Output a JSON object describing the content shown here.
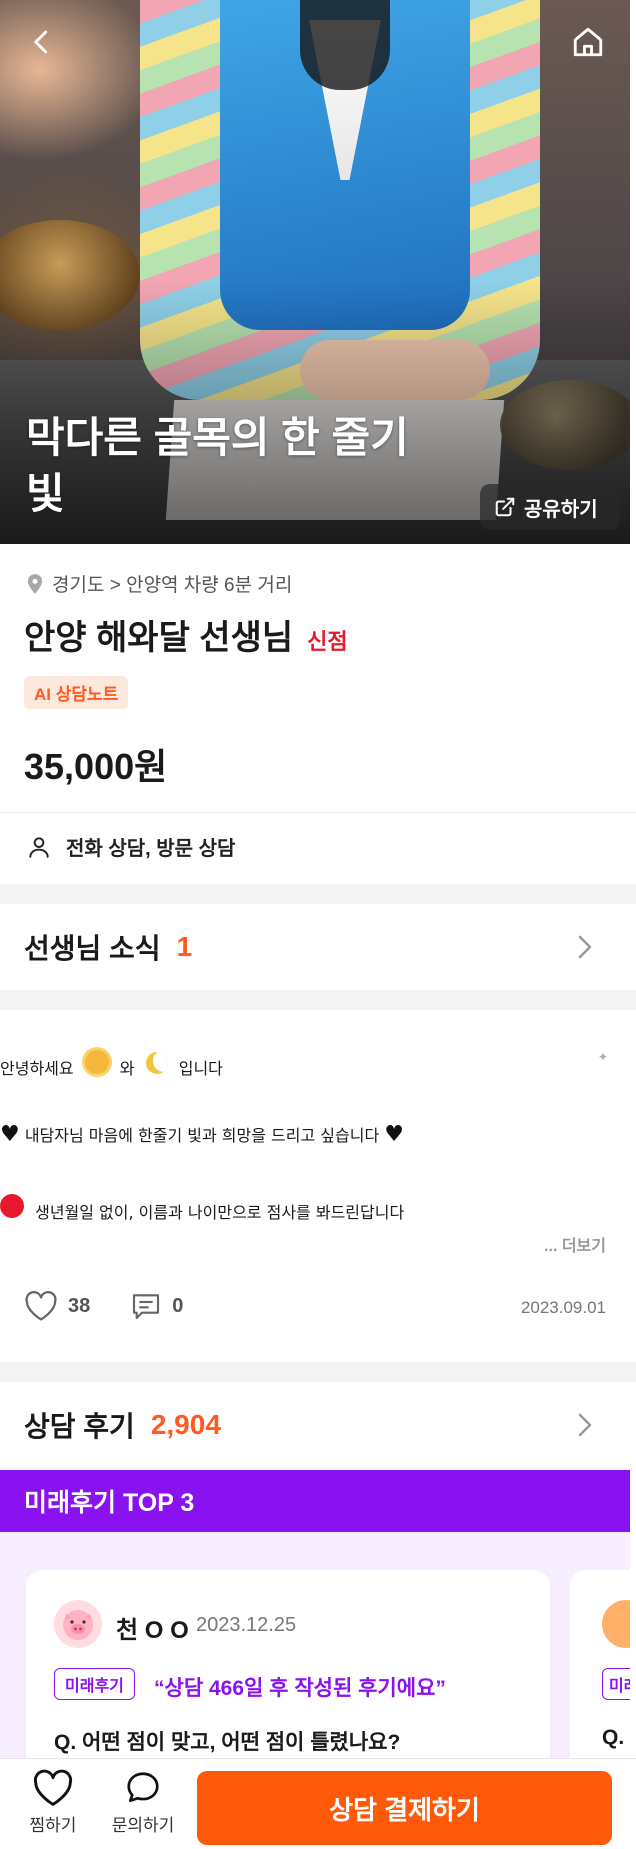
{
  "hero": {
    "title": "막다른 골목의 한 줄기 빛",
    "share_label": "공유하기"
  },
  "shop": {
    "location": "경기도 > 안양역 차량 6분 거리",
    "name": "안양 해와달 선생님",
    "new_badge": "신점",
    "ai_badge": "AI 상담노트",
    "price": "35,000원",
    "consult_types": "전화 상담, 방문 상담"
  },
  "news_section": {
    "title": "선생님 소식",
    "count": "1",
    "line1_pre": "안녕하세요",
    "line1_mid": "와",
    "line1_post": "입니다",
    "line2": "내담자님 마음에 한줄기 빛과 희망을 드리고 싶습니다",
    "line3": "생년월일 없이, 이름과 나이만으로 점사를 봐드린답니다",
    "more": "... 더보기",
    "likes": "38",
    "comments": "0",
    "date": "2023.09.01"
  },
  "review_section": {
    "title": "상담 후기",
    "count": "2,904",
    "top3_title": "미래후기 TOP 3",
    "cards": [
      {
        "reviewer": "천 O O",
        "date": "2023.12.25",
        "tag": "미래후기",
        "quote": "“상담 466일 후 작성된 후기에요”",
        "question": "Q. 어떤 점이 맞고, 어떤 점이 틀렸나요?"
      },
      {
        "tag": "미래후기",
        "question": "Q."
      }
    ]
  },
  "bottom_bar": {
    "wish_label": "찜하기",
    "inquiry_label": "문의하기",
    "pay_label": "상담 결제하기"
  },
  "colors": {
    "accent_orange": "#ff5a0a",
    "purple": "#8b12f0",
    "new_red": "#e8192c"
  }
}
